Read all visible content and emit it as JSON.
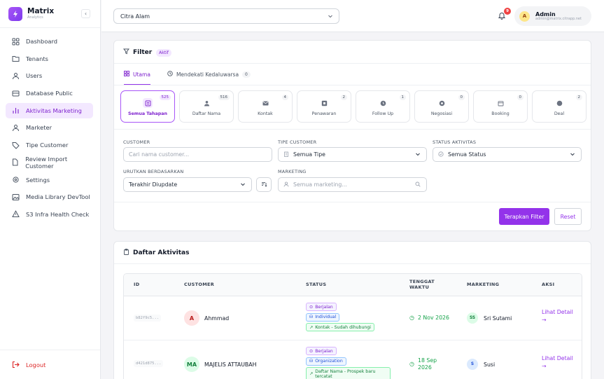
{
  "brand": {
    "name": "Matrix",
    "sub": "Analytics"
  },
  "sidebar": {
    "items": [
      {
        "label": "Dashboard",
        "icon": "grid-icon"
      },
      {
        "label": "Tenants",
        "icon": "folder-icon"
      },
      {
        "label": "Users",
        "icon": "users-icon"
      },
      {
        "label": "Database Public",
        "icon": "database-icon"
      },
      {
        "label": "Aktivitas Marketing",
        "icon": "chart-icon",
        "active": true
      },
      {
        "label": "Marketer",
        "icon": "users-icon"
      },
      {
        "label": "Tipe Customer",
        "icon": "tag-icon"
      },
      {
        "label": "Review Import Customer",
        "icon": "file-icon"
      },
      {
        "label": "Settings",
        "icon": "gear-icon"
      },
      {
        "label": "Media Library DevTool",
        "icon": "image-icon"
      },
      {
        "label": "S3 Infra Health Check",
        "icon": "alert-icon"
      }
    ],
    "logout": "Logout"
  },
  "topbar": {
    "org": "Citra Alam",
    "notif_count": "9",
    "user": {
      "initial": "A",
      "name": "Admin",
      "email": "admin@matrix.citrapp.net"
    }
  },
  "filter": {
    "title": "Filter",
    "badge": "Aktif",
    "tabs": [
      {
        "label": "Utama",
        "active": true
      },
      {
        "label": "Mendekati Kedaluwarsa",
        "count": "0"
      }
    ],
    "stages": [
      {
        "label": "Semua Tahapan",
        "count": "525",
        "active": true
      },
      {
        "label": "Daftar Nama",
        "count": "516"
      },
      {
        "label": "Kontak",
        "count": "4"
      },
      {
        "label": "Penawaran",
        "count": "2"
      },
      {
        "label": "Follow Up",
        "count": "1"
      },
      {
        "label": "Negosiasi",
        "count": "0"
      },
      {
        "label": "Booking",
        "count": "0"
      },
      {
        "label": "Deal",
        "count": "2"
      }
    ],
    "customer": {
      "label": "CUSTOMER",
      "placeholder": "Cari nama customer..."
    },
    "tipe": {
      "label": "TIPE CUSTOMER",
      "value": "Semua Tipe"
    },
    "status": {
      "label": "STATUS AKTIVITAS",
      "value": "Semua Status"
    },
    "sort": {
      "label": "URUTKAN BERDASARKAN",
      "value": "Terakhir Diupdate"
    },
    "marketing": {
      "label": "MARKETING",
      "placeholder": "Semua marketing..."
    },
    "apply": "Terapkan Filter",
    "reset": "Reset"
  },
  "activities": {
    "title": "Daftar Aktivitas",
    "columns": {
      "id": "ID",
      "customer": "CUSTOMER",
      "status": "STATUS",
      "due": "TENGGAT WAKTU",
      "marketing": "MARKETING",
      "action": "AKSI"
    },
    "rows": [
      {
        "id": "b82f9c5...",
        "initial": "A",
        "customer": "Ahmmad",
        "status": "Berjalan",
        "type": "Individual",
        "stage": "Kontak - Sudah dihubungi",
        "due": "2 Nov 2026",
        "mk_initial": "SS",
        "marketing": "Sri Sutami",
        "action": "Lihat Detail →"
      },
      {
        "id": "d421d875...",
        "initial": "MA",
        "customer": "MAJELIS ATTAUBAH",
        "status": "Berjalan",
        "type": "Organization",
        "stage": "Daftar Nama - Prospek baru tercatat",
        "due": "18 Sep 2026",
        "mk_initial": "S",
        "marketing": "Susi",
        "action": "Lihat Detail →"
      }
    ]
  },
  "colors": {
    "accent": "#9333ea",
    "accent_soft": "#f3e8ff",
    "danger": "#dc2626",
    "success": "#16a34a"
  }
}
